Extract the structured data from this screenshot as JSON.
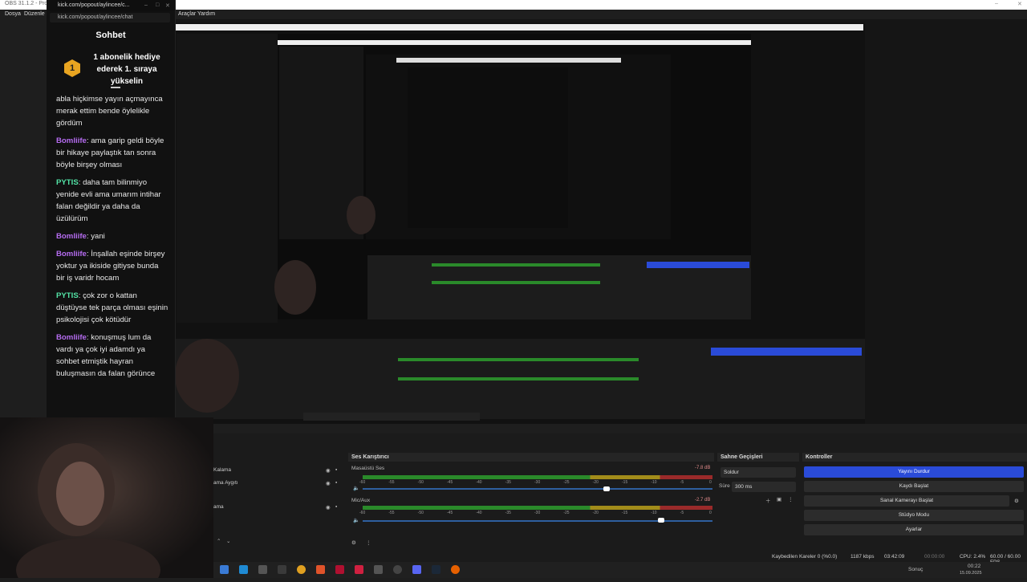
{
  "obs": {
    "title": "OBS 31.1.2 - Profil: ...",
    "menu": [
      "Dosya",
      "Düzenle",
      "Araçlar",
      "Yardım"
    ]
  },
  "chat_window": {
    "tab_title": "kick.com/popout/aylincee/c...",
    "url": "kick.com/popout/aylincee/chat",
    "heading": "Sohbet",
    "pinned": {
      "badge": "1",
      "text": "1 abonelik hediye ederek 1. sıraya yükselin"
    },
    "messages": [
      {
        "user": "",
        "color": "#eaeaea",
        "text": "abla hiçkimse yayın açmayınca merak ettim bende öylelikle gördüm"
      },
      {
        "user": "Bomliife",
        "color": "#b56cf0",
        "text": ": ama garip geldi böyle bir hikaye paylaştık tan sonra böyle birşey olması"
      },
      {
        "user": "PYTIS",
        "color": "#53e3a6",
        "text": ": daha tam bilinmiyo yenide evli ama umarım intihar falan değildir ya daha da üzülürüm"
      },
      {
        "user": "Bomliife",
        "color": "#b56cf0",
        "text": ": yani"
      },
      {
        "user": "Bomliife",
        "color": "#b56cf0",
        "text": ": İnşallah eşinde birşey yoktur ya ikiside gitiyse bunda bir iş varidr hocam"
      },
      {
        "user": "PYTIS",
        "color": "#53e3a6",
        "text": ": çok zor o kattan düştüyse tek parça olması eşinin psikolojisi çok kötüdür"
      },
      {
        "user": "Bomliife",
        "color": "#b56cf0",
        "text": ": konuşmuş lum da vardı ya çok iyi adamdı ya sohbet etmiştik hayran buluşmasın da falan görünce"
      }
    ]
  },
  "docks": {
    "sources": {
      "items": [
        "Kalama",
        "ama Aygıtı",
        "ama"
      ]
    },
    "mixer": {
      "title": "Ses Karıştırıcı",
      "channels": [
        {
          "name": "Masaüstü Ses",
          "db": "-7.8 dB",
          "level": 0.92
        },
        {
          "name": "Mic/Aux",
          "db": "-2.7 dB",
          "level": 0.91
        }
      ],
      "scale": [
        "-60",
        "-55",
        "-50",
        "-45",
        "-40",
        "-35",
        "-30",
        "-25",
        "-20",
        "-15",
        "-10",
        "-5",
        "0"
      ]
    },
    "transitions": {
      "title": "Sahne Geçişleri",
      "selected": "Soldur",
      "duration_label": "Süre",
      "duration_value": "300 ms"
    },
    "controls": {
      "title": "Kontroller",
      "buttons": [
        "Yayını Durdur",
        "Kaydı Başlat",
        "Sanal Kamerayı Başlat",
        "Stüdyo Modu",
        "Ayarlar"
      ]
    }
  },
  "status": {
    "dropped": "Kaybedilen Kareler 0 (%0.0)",
    "bitrate": "1187 kbps",
    "stream_time": "03:42:09",
    "rec_time": "00:00:00",
    "cpu": "CPU: 2.4%",
    "fps": "60.00 / 60.00 FPS"
  },
  "taskbar": {
    "weather": "Sonuç",
    "time": "00:22",
    "date": "15.09.2025"
  },
  "colors": {
    "accent": "#2a4bd8",
    "kick_green": "#53fc18"
  }
}
